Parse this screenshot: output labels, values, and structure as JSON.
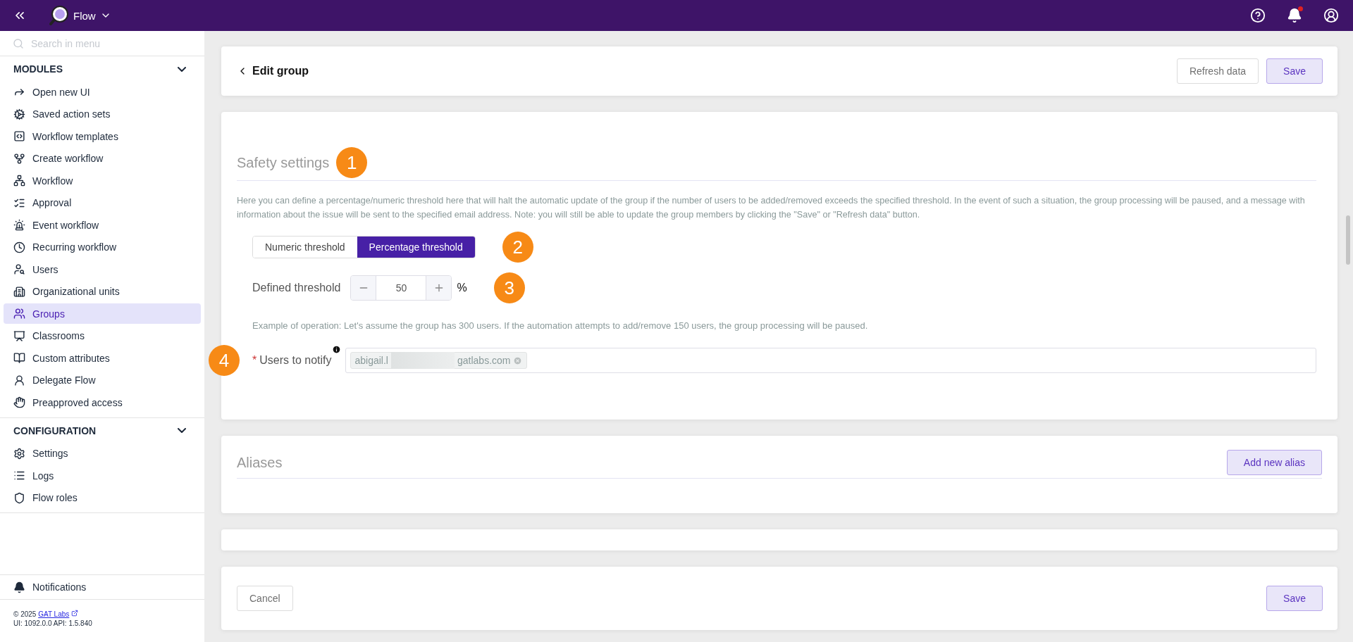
{
  "topbar": {
    "app_name": "Flow",
    "has_unread": true
  },
  "sidebar": {
    "search_placeholder": "Search in menu",
    "sections": [
      {
        "title": "MODULES",
        "expanded": true,
        "items": [
          {
            "label": "Open new UI",
            "selected": false
          },
          {
            "label": "Saved action sets",
            "selected": false
          },
          {
            "label": "Workflow templates",
            "selected": false
          },
          {
            "label": "Create workflow",
            "selected": false
          },
          {
            "label": "Workflow",
            "selected": false
          },
          {
            "label": "Approval",
            "selected": false
          },
          {
            "label": "Event workflow",
            "selected": false
          },
          {
            "label": "Recurring workflow",
            "selected": false
          },
          {
            "label": "Users",
            "selected": false
          },
          {
            "label": "Organizational units",
            "selected": false
          },
          {
            "label": "Groups",
            "selected": true
          },
          {
            "label": "Classrooms",
            "selected": false
          },
          {
            "label": "Custom attributes",
            "selected": false
          },
          {
            "label": "Delegate Flow",
            "selected": false
          },
          {
            "label": "Preapproved access",
            "selected": false
          }
        ]
      },
      {
        "title": "CONFIGURATION",
        "expanded": true,
        "items": [
          {
            "label": "Settings",
            "selected": false
          },
          {
            "label": "Logs",
            "selected": false
          },
          {
            "label": "Flow roles",
            "selected": false
          }
        ]
      }
    ],
    "notifications": "Notifications",
    "copyright": "© 2025",
    "company_link": "GAT Labs",
    "version": "UI: 1092.0.0 API: 1.5.840"
  },
  "header": {
    "title": "Edit group",
    "buttons": [
      {
        "label": "Refresh data",
        "kind": "secondary"
      },
      {
        "label": "Save",
        "kind": "primary"
      }
    ]
  },
  "safety": {
    "title": "Safety settings",
    "marker": "1",
    "description": "Here you can define a percentage/numeric threshold here that will halt the automatic update of the group if the number of users to be added/removed exceeds the specified threshold. In the event of such a situation, the group processing will be paused, and a message with information about the issue will be sent to the specified email address. Note: you will still be able to update the group members by clicking the \"Save\" or \"Refresh data\" button.",
    "modes": [
      {
        "label": "Numeric threshold",
        "selected": false
      },
      {
        "label": "Percentage threshold",
        "selected": true
      }
    ],
    "modes_marker": "2",
    "threshold": {
      "label": "Defined threshold",
      "value": "50",
      "unit": "%",
      "marker": "3"
    },
    "example": "Example of operation: Let's assume the group has 300 users. If the automation attempts to add/remove 150 users, the group processing will be paused.",
    "notify": {
      "marker": "4",
      "required": true,
      "required_mark": "*",
      "label": "Users to notify",
      "chips": [
        {
          "start": "abigail.l",
          "end": "gatlabs.com"
        }
      ]
    }
  },
  "aliases": {
    "title": "Aliases",
    "button": "Add new alias"
  },
  "footer": {
    "buttons": [
      {
        "label": "Cancel",
        "kind": "secondary"
      },
      {
        "label": "Save",
        "kind": "primary"
      }
    ]
  }
}
